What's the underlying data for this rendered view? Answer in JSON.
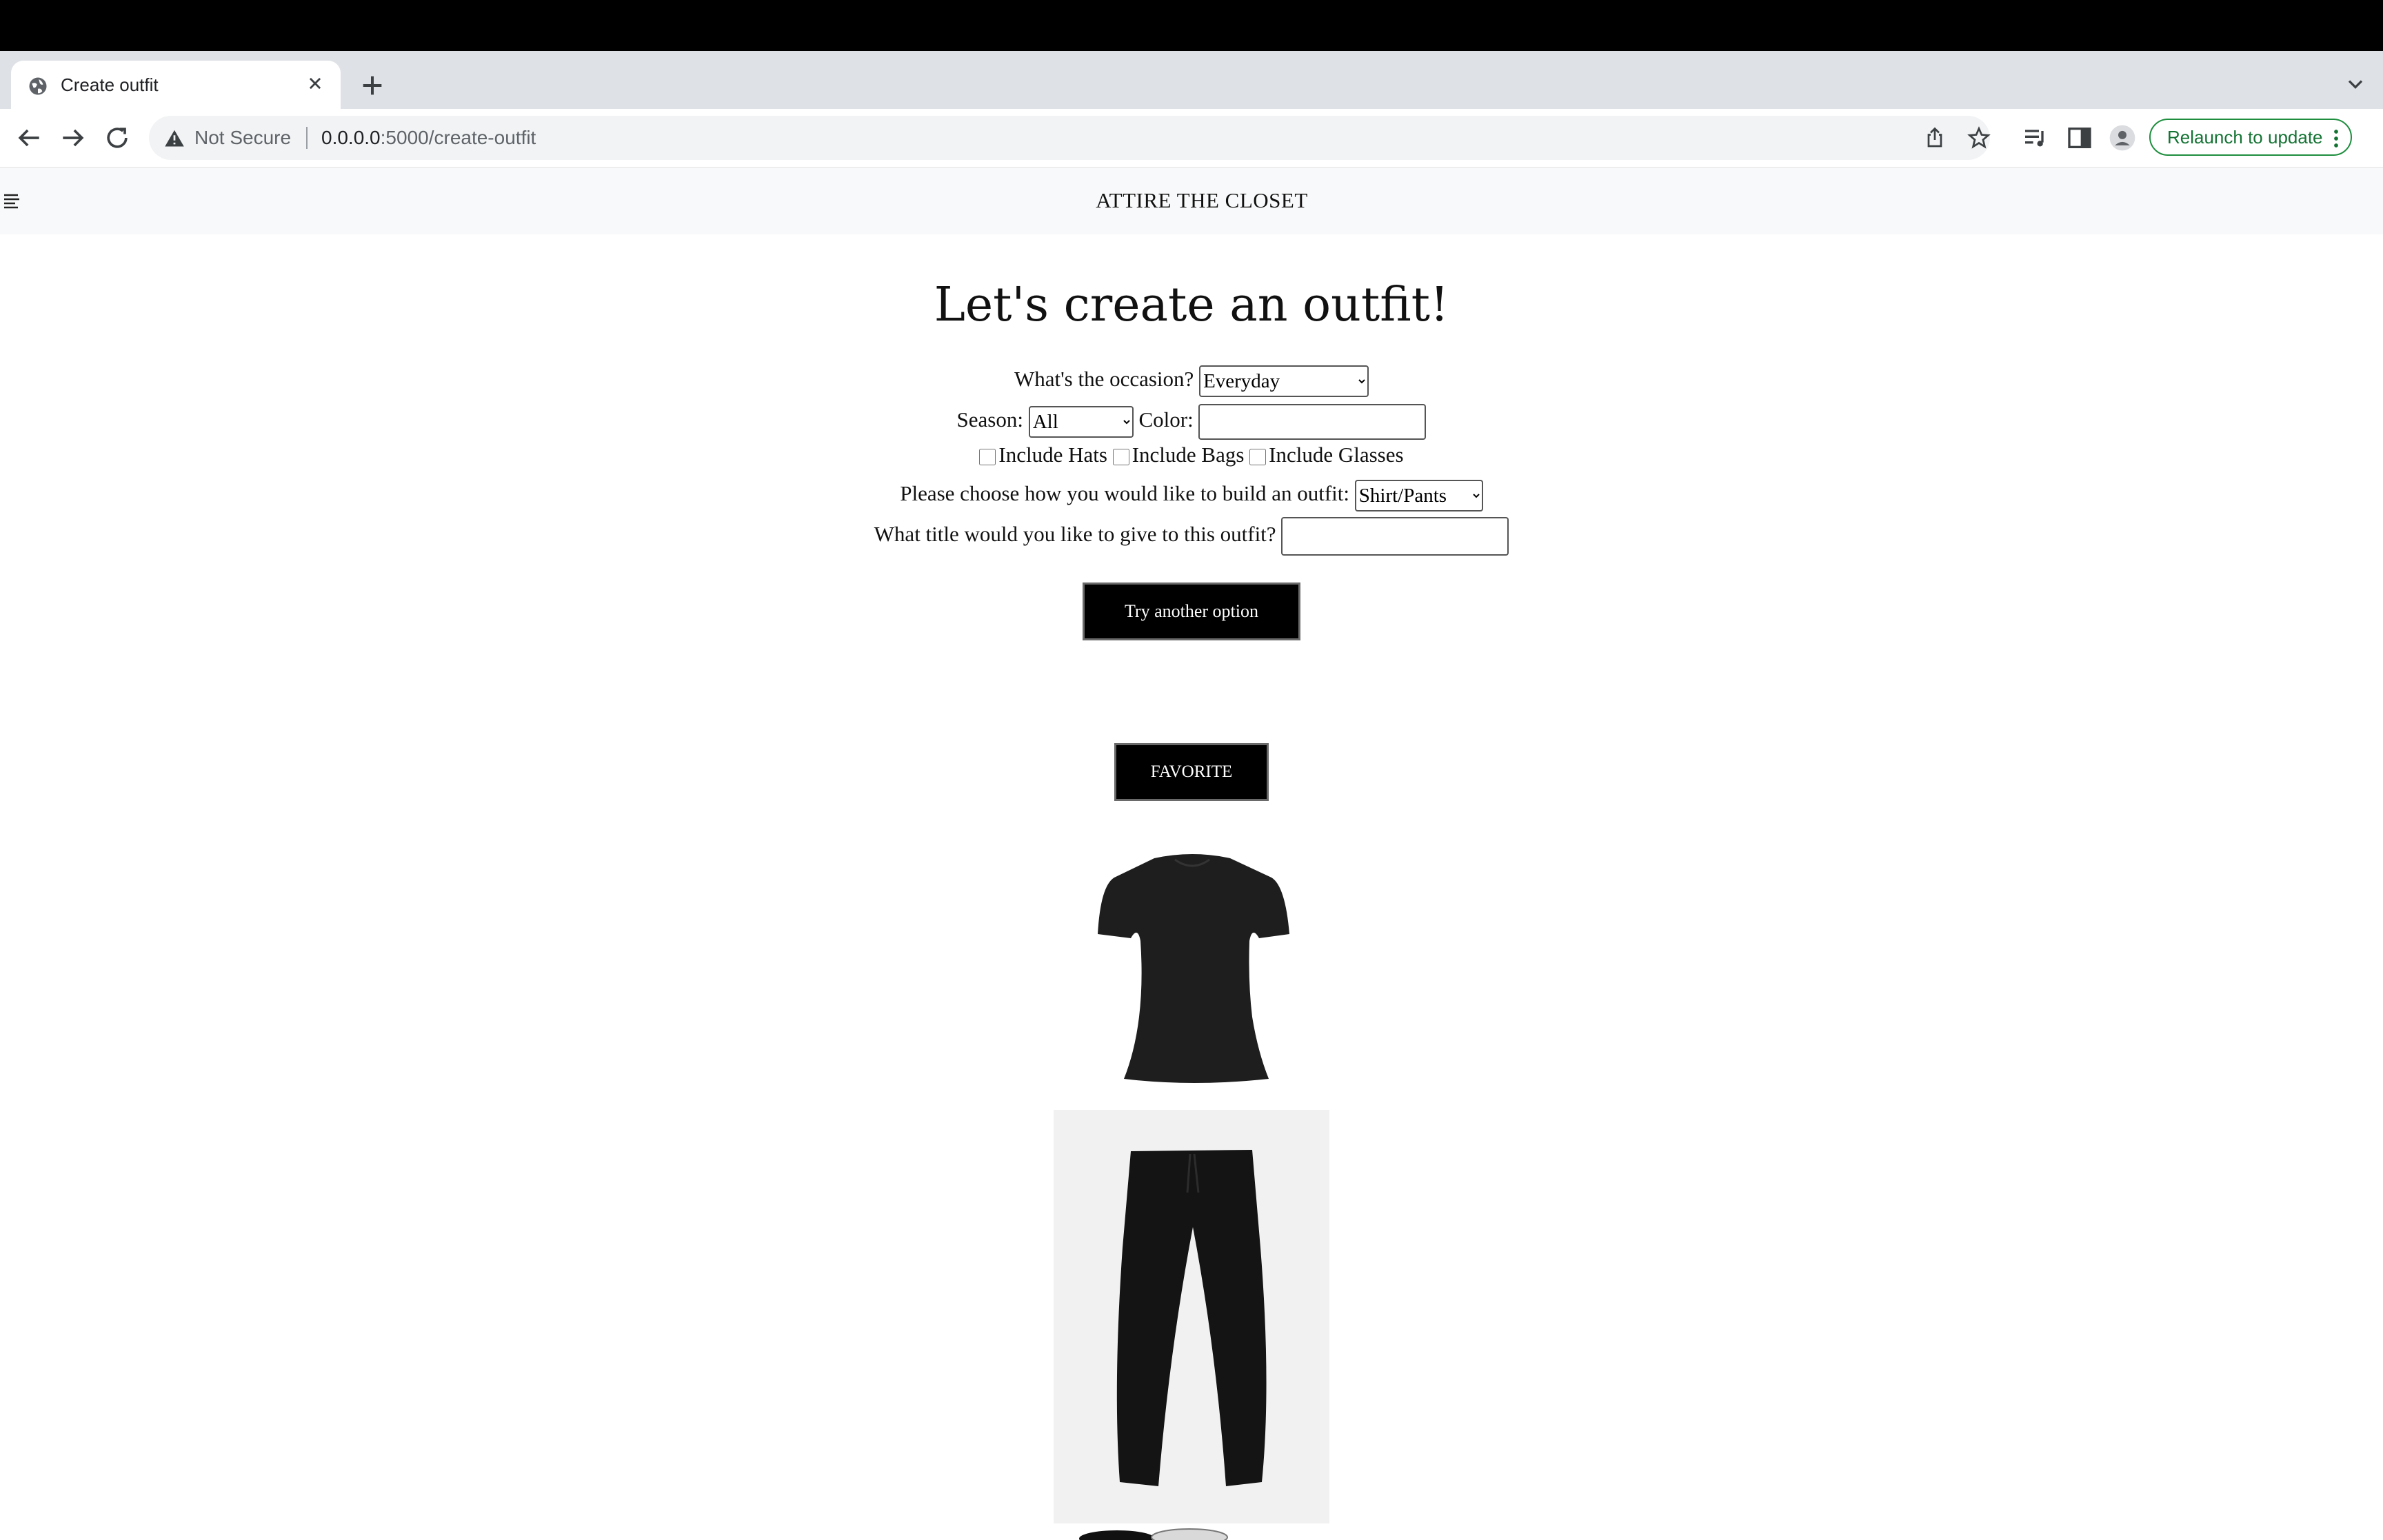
{
  "browser": {
    "tab_title": "Create outfit",
    "security_label": "Not Secure",
    "url_host": "0.0.0.0",
    "url_path": ":5000/create-outfit",
    "relaunch_label": "Relaunch to update"
  },
  "site": {
    "brand": "ATTIRE THE CLOSET"
  },
  "form": {
    "heading": "Let's create an outfit!",
    "occasion_label": "What's the occasion?",
    "occasion_value": "Everyday",
    "season_label": "Season:",
    "season_value": "All",
    "color_label": "Color:",
    "color_value": "",
    "include_hats_label": "Include Hats",
    "include_bags_label": "Include Bags",
    "include_glasses_label": "Include Glasses",
    "build_label": "Please choose how you would like to build an outfit:",
    "build_value": "Shirt/Pants",
    "title_label": "What title would you like to give to this outfit?",
    "title_value": "",
    "try_button": "Try another option",
    "favorite_button": "FAVORITE"
  },
  "colors": {
    "button_bg": "#000000",
    "relaunch_green": "#137333"
  },
  "icons": [
    "globe-icon",
    "close-icon",
    "plus-icon",
    "chevron-down-icon",
    "back-arrow-icon",
    "forward-arrow-icon",
    "reload-icon",
    "warning-icon",
    "share-icon",
    "star-icon",
    "media-icon",
    "side-panel-icon",
    "profile-icon",
    "kebab-menu-icon",
    "hamburger-icon"
  ]
}
